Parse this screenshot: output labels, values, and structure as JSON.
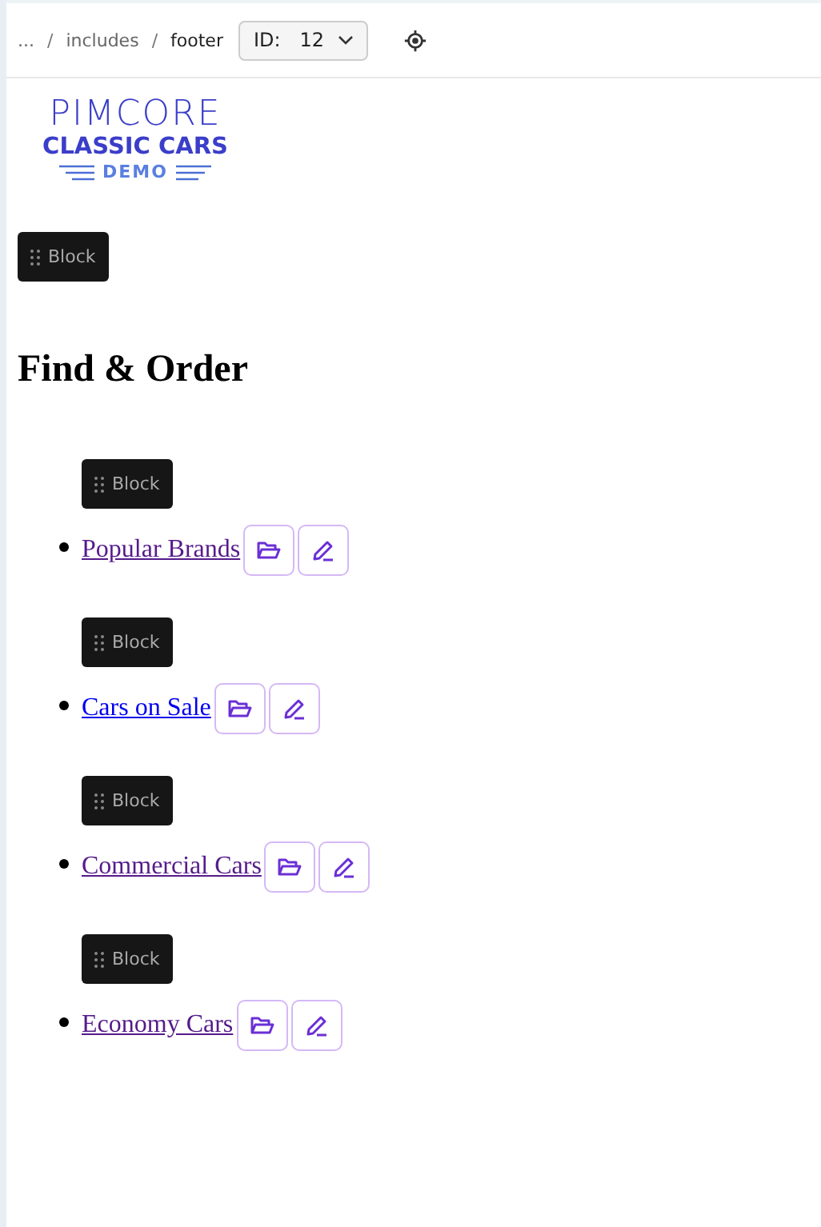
{
  "breadcrumb": {
    "items": [
      "...",
      "includes",
      "footer"
    ],
    "separator": "/"
  },
  "id_selector": {
    "label": "ID:",
    "value": "12"
  },
  "logo": {
    "line_1": "PIMCORE",
    "line_2": "CLASSIC CARS",
    "line_3": "DEMO"
  },
  "block_label": "Block",
  "heading": "Find & Order",
  "links": [
    {
      "block_label": "Block",
      "text": "Popular Brands",
      "visited": true
    },
    {
      "block_label": "Block",
      "text": "Cars on Sale",
      "visited": false
    },
    {
      "block_label": "Block",
      "text": "Commercial Cars",
      "visited": true
    },
    {
      "block_label": "Block",
      "text": "Economy Cars",
      "visited": true
    }
  ]
}
